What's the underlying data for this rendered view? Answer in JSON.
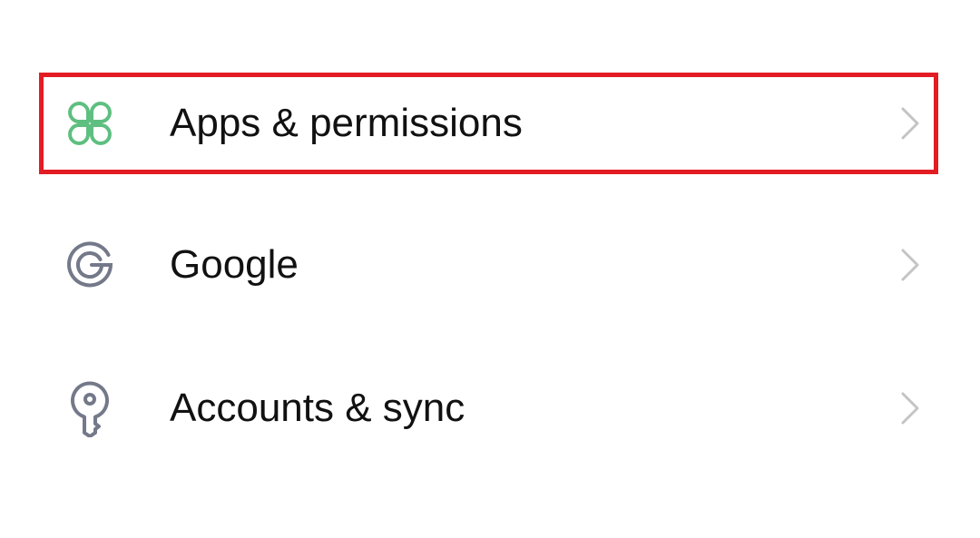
{
  "settings": {
    "items": [
      {
        "label": "Apps & permissions",
        "icon": "apps-clover-icon",
        "icon_color": "#5ebf80"
      },
      {
        "label": "Google",
        "icon": "google-g-icon",
        "icon_color": "#74798a"
      },
      {
        "label": "Accounts & sync",
        "icon": "key-icon",
        "icon_color": "#74798a"
      }
    ],
    "chevron_color": "#c4c4c4",
    "highlight_color": "#e31c24"
  }
}
